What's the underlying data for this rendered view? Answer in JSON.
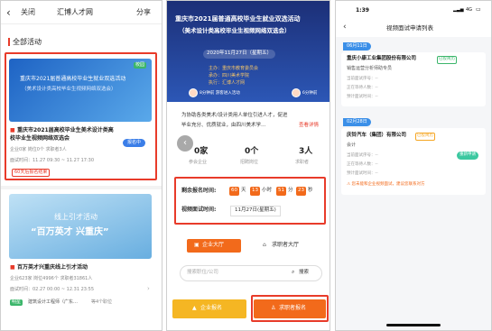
{
  "p1": {
    "close": "关闭",
    "title": "汇博人才网",
    "share": "分享",
    "section": "全部活动",
    "card1": {
      "tag": "校园",
      "banner_line1": "重庆市2021届普通高校毕业生就业双选活动",
      "banner_line2": "（美术设计类高校毕业生视频网络双选会）",
      "title_line1": "重庆市2021届高校毕业生美术设计类高",
      "title_line2": "校毕业生视频网络双选会",
      "stats": "企业0家  岗位0个  求职者3人",
      "status": "报名中",
      "time": "面试时间：11.27 09:30 ~ 11.27 17:30",
      "countdown": "60天后报名结束"
    },
    "card2": {
      "banner_line1": "线上引才活动",
      "banner_line2": "“百万英才 兴重庆”",
      "title": "百万英才兴重庆线上引才活动",
      "stats": "企业623家  岗位4996个  求职者31861人",
      "time": "面试时间：02.27 00:00 ~ 12.31 23:55",
      "tag": "明星",
      "company": "建筑设计工程师（广东…",
      "more": "等4个职位"
    }
  },
  "p2": {
    "title_line1": "重庆市2021届普通高校毕业生就业双选活动",
    "title_line2": "（美术设计类高校毕业生视频网络双选会）",
    "date": "2020年11月27日（星期五）",
    "host1": "主办：重庆市教育委员会",
    "host2": "承办：四川美术学院",
    "host3": "执行：汇博人才网",
    "speaker_left": "8分钟前 游客进入活动",
    "speaker_right": "6分钟前",
    "intro_line1": "为协助各类美术/设计类用人单位引进人才，促进",
    "intro_line2": "毕业充分、优质就业，由四川美术学…",
    "intro_more": "查看详情",
    "stats": [
      {
        "value": "0家",
        "label": "参会企业"
      },
      {
        "value": "0个",
        "label": "招聘岗位"
      },
      {
        "value": "3人",
        "label": "求职者"
      }
    ],
    "countdown_label": "剩余报名时间:",
    "countdown": [
      {
        "num": "60",
        "unit": "天"
      },
      {
        "num": "13",
        "unit": "小时"
      },
      {
        "num": "51",
        "unit": "分"
      },
      {
        "num": "23",
        "unit": "秒"
      }
    ],
    "interview_label": "视频面试时间:",
    "interview_date": "11月27日(星期五)",
    "tab_company": "企业大厅",
    "tab_seeker": "求职者大厅",
    "search_placeholder": "搜索职位/公司",
    "search_btn": "搜索",
    "btn_company": "企业报名",
    "btn_seeker": "求职者报名"
  },
  "p3": {
    "time": "1:39",
    "signal": "4G",
    "title": "视频面试申请列表",
    "group1": {
      "date": "06月11日",
      "company": "重庆小康工业集团股份有限公司",
      "tag": "已投简历",
      "job": "销售运营分析师助专员",
      "row1": "当前面试序号：--",
      "row2": "正在等待人数：--",
      "row3": "预计面试时间：--"
    },
    "group2": {
      "date": "02月28日",
      "company": "庆铃汽车（集团）有限公司",
      "tag": "已投简历",
      "job": "会计",
      "row1": "当前面试序号：--",
      "row2": "正在等待人数：--",
      "row3": "预计面试时间：--",
      "action": "重新申请",
      "warn": "⚠ 您未能和企业视频面试，建议您联系对方"
    }
  }
}
